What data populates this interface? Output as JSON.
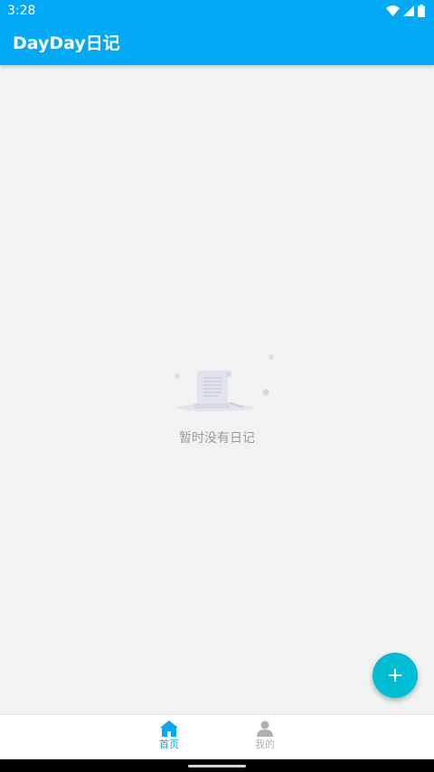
{
  "status_bar": {
    "time": "3:28"
  },
  "app_bar": {
    "title": "DayDay日记"
  },
  "empty_state": {
    "message": "暂时没有日记"
  },
  "fab": {
    "icon": "plus-icon"
  },
  "bottom_nav": {
    "items": [
      {
        "label": "首页",
        "icon": "home-icon",
        "selected": true
      },
      {
        "label": "我的",
        "icon": "person-icon",
        "selected": false
      }
    ]
  },
  "colors": {
    "primary": "#03a9f4",
    "accent": "#00bcd4",
    "background": "#f1f2f2",
    "muted_text": "#9a9a9a"
  }
}
